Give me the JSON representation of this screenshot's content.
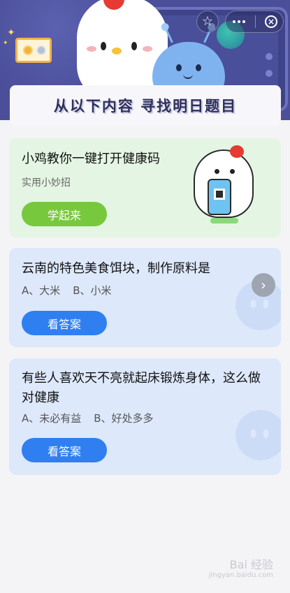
{
  "header": {
    "banner_text": "从以下内容  寻找明日题目"
  },
  "toolbar": {
    "favorite_icon": "☆",
    "close_icon": "×"
  },
  "promo_card": {
    "title": "小鸡教你一键打开健康码",
    "subtitle": "实用小妙招",
    "button_label": "学起来"
  },
  "questions": [
    {
      "title": "云南的特色美食饵块，制作原料是",
      "option_a": "A、大米",
      "option_b": "B、小米",
      "button_label": "看答案",
      "arrow_icon": "›"
    },
    {
      "title": "有些人喜欢天不亮就起床锻炼身体，这么做对健康",
      "option_a": "A、未必有益",
      "option_b": "B、好处多多",
      "button_label": "看答案"
    }
  ],
  "watermark": {
    "text": "Bai 经验",
    "url": "jingyan.baidu.com"
  },
  "colors": {
    "header_bg": "#4b4f9a",
    "promo_bg": "#e4f5e4",
    "question_bg": "#dde8fb",
    "green_button": "#78c83e",
    "blue_button": "#2f7ff0"
  }
}
